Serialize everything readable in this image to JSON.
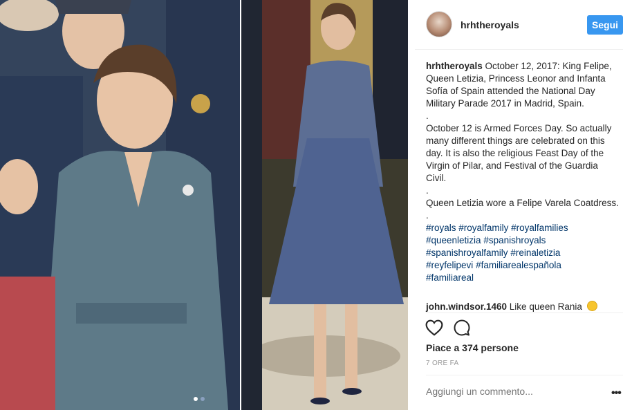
{
  "header": {
    "username": "hrhtheroyals",
    "follow_label": "Segui"
  },
  "caption": {
    "author": "hrhtheroyals",
    "paragraphs": [
      "October 12, 2017: King Felipe, Queen Letizia, Princess Leonor and Infanta Sofía of Spain attended the National Day Military Parade 2017 in Madrid, Spain.",
      ".",
      "October 12 is Armed Forces Day. So actually many different things are celebrated on this day. It is also the religious Feast Day of the Virgin of Pilar, and Festival of the Guardia Civil.",
      ".",
      "Queen Letizia wore a Felipe Varela Coatdress.",
      "."
    ],
    "hashtags": [
      "#royals",
      "#royalfamily",
      "#royalfamilies",
      "#queenletizia",
      "#spanishroyals",
      "#spanishroyalfamily",
      "#reinaletizia",
      "#reyfelipevi",
      "#familiarealespañola",
      "#familiareal"
    ]
  },
  "comment": {
    "author": "john.windsor.1460",
    "text": "Like queen Rania"
  },
  "likes": "Piace a 374 persone",
  "timestamp": "7 ORE FA",
  "add_comment_placeholder": "Aggiungi un commento...",
  "more_label": "•••",
  "colors": {
    "accent": "#3897f0",
    "hashtag": "#003569",
    "muted": "#999999"
  },
  "icons": [
    "heart-icon",
    "comment-icon",
    "more-icon"
  ]
}
